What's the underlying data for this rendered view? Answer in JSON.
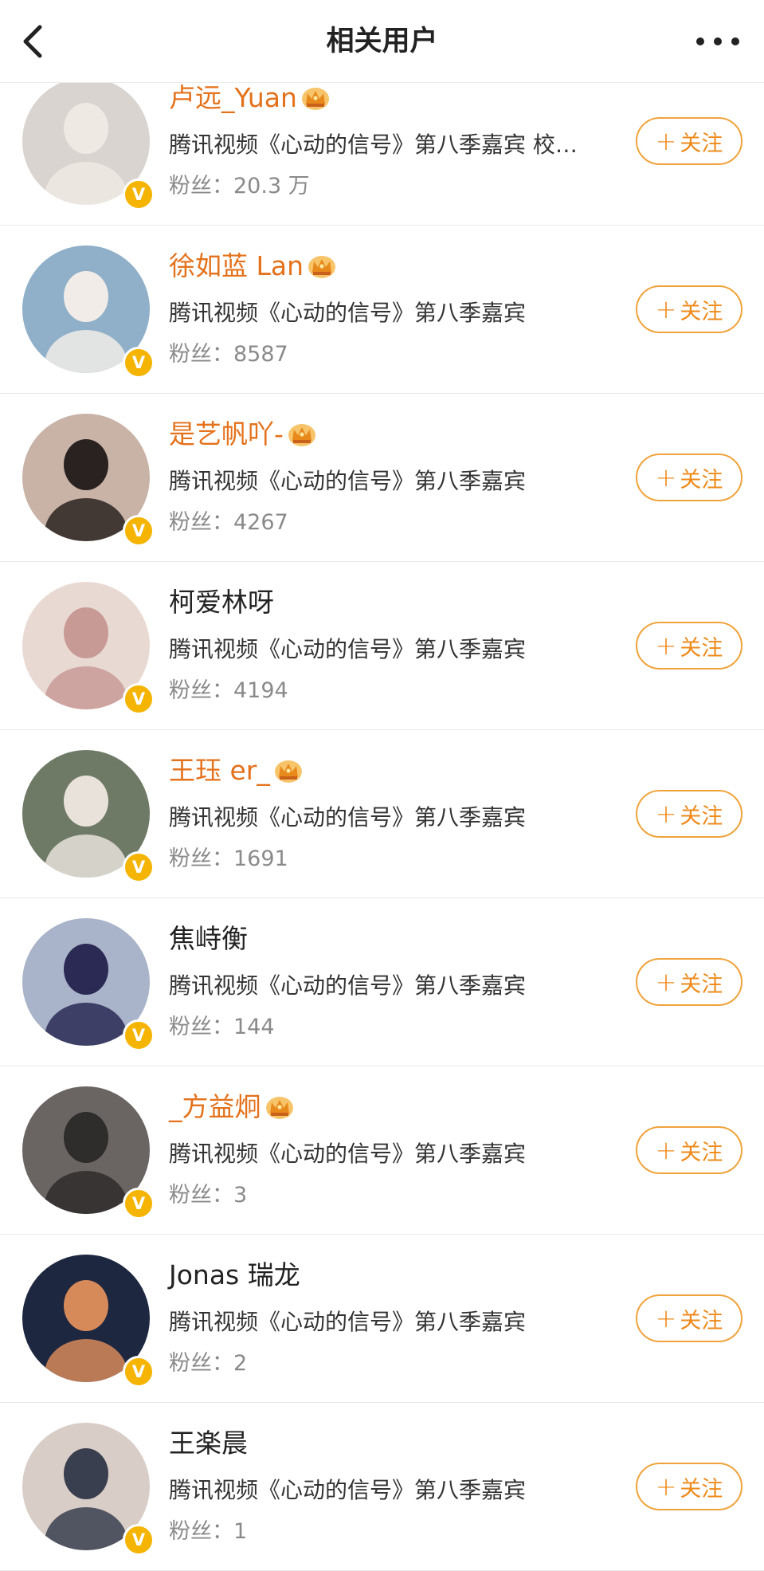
{
  "header": {
    "title": "相关用户",
    "back_icon": "chevron-left-icon",
    "more_icon": "more-dots-icon"
  },
  "colors": {
    "vip_name": "#e4711b",
    "follow_accent": "#ee8a1b",
    "verified_badge": "#f5b400"
  },
  "follow_label": "关注",
  "users": [
    {
      "name": "卢远_Yuan",
      "vip": true,
      "desc": "腾讯视频《心动的信号》第八季嘉宾 校…",
      "fans_label": "粉丝：",
      "fans": "20.3 万",
      "avatar_bg": "#d9d4cf",
      "avatar_fg": "#efe9e4"
    },
    {
      "name": "徐如蓝 Lan",
      "vip": true,
      "desc": "腾讯视频《心动的信号》第八季嘉宾",
      "fans_label": "粉丝：",
      "fans": "8587",
      "avatar_bg": "#8fb0c8",
      "avatar_fg": "#f1ece8"
    },
    {
      "name": "是艺帆吖-",
      "vip": true,
      "desc": "腾讯视频《心动的信号》第八季嘉宾",
      "fans_label": "粉丝：",
      "fans": "4267",
      "avatar_bg": "#c9b2a6",
      "avatar_fg": "#2a2220"
    },
    {
      "name": "柯爱林呀",
      "vip": false,
      "desc": "腾讯视频《心动的信号》第八季嘉宾",
      "fans_label": "粉丝：",
      "fans": "4194",
      "avatar_bg": "#e9d9d3",
      "avatar_fg": "#c89a96"
    },
    {
      "name": "王珏 er_",
      "vip": true,
      "desc": "腾讯视频《心动的信号》第八季嘉宾",
      "fans_label": "粉丝：",
      "fans": "1691",
      "avatar_bg": "#6f7a66",
      "avatar_fg": "#e8e2da"
    },
    {
      "name": "焦峙衡",
      "vip": false,
      "desc": "腾讯视频《心动的信号》第八季嘉宾",
      "fans_label": "粉丝：",
      "fans": "144",
      "avatar_bg": "#a9b3c9",
      "avatar_fg": "#2b2a55"
    },
    {
      "name": "_方益炯",
      "vip": true,
      "desc": "腾讯视频《心动的信号》第八季嘉宾",
      "fans_label": "粉丝：",
      "fans": "3",
      "avatar_bg": "#6a6563",
      "avatar_fg": "#2f2c2c"
    },
    {
      "name": "Jonas 瑞龙",
      "vip": false,
      "desc": "腾讯视频《心动的信号》第八季嘉宾",
      "fans_label": "粉丝：",
      "fans": "2",
      "avatar_bg": "#1d2740",
      "avatar_fg": "#d68a5a"
    },
    {
      "name": "王楽晨",
      "vip": false,
      "desc": "腾讯视频《心动的信号》第八季嘉宾",
      "fans_label": "粉丝：",
      "fans": "1",
      "avatar_bg": "#d8cdc7",
      "avatar_fg": "#3a3f4f"
    }
  ]
}
